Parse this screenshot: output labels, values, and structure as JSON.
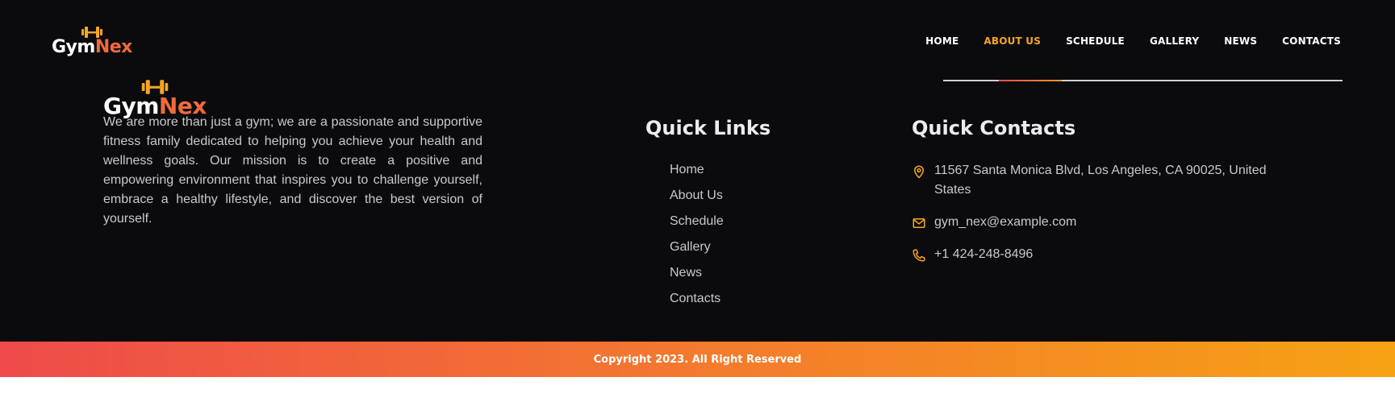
{
  "brand": {
    "part1": "Gym",
    "part2": "Nex",
    "icon": "dumbbell-icon"
  },
  "colors": {
    "background": "#0b0b0e",
    "accent_orange": "#f5a623",
    "accent_red": "#ee4a4a",
    "text_muted": "#c9c9cc"
  },
  "nav": {
    "items": [
      {
        "label": "HOME",
        "active": false
      },
      {
        "label": "ABOUT US",
        "active": true
      },
      {
        "label": "SCHEDULE",
        "active": false
      },
      {
        "label": "GALLERY",
        "active": false
      },
      {
        "label": "NEWS",
        "active": false
      },
      {
        "label": "CONTACTS",
        "active": false
      }
    ]
  },
  "about": {
    "text": "We are more than just a gym; we are a passionate and supportive fitness family dedicated to helping you achieve your health and wellness goals. Our mission is to create a positive and empowering environment that inspires you to challenge yourself, embrace a healthy lifestyle, and discover the best version of yourself."
  },
  "quick_links": {
    "title": "Quick Links",
    "items": [
      "Home",
      "About Us",
      "Schedule",
      "Gallery",
      "News",
      "Contacts"
    ]
  },
  "quick_contacts": {
    "title": "Quick Contacts",
    "address": "11567 Santa Monica Blvd, Los Angeles, CA 90025, United States",
    "email": "gym_nex@example.com",
    "phone": "+1 424-248-8496",
    "icons": [
      "location-pin-icon",
      "mail-icon",
      "phone-icon"
    ]
  },
  "footer": {
    "copyright": "Copyright 2023. All Right Reserved"
  }
}
